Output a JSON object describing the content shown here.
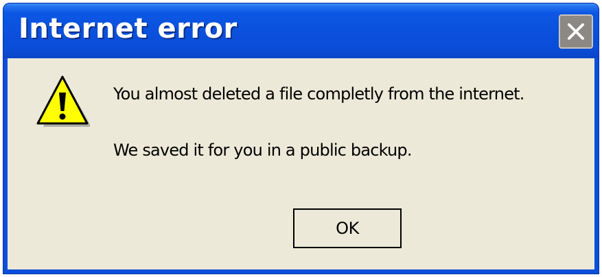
{
  "window": {
    "title": "Internet error"
  },
  "titlebar": {
    "close_icon": "close-icon"
  },
  "dialog": {
    "icon": "warning-icon",
    "message_line1": "You almost deleted a file completly from the internet.",
    "message_line2": "We saved it for you in a public backup.",
    "ok_label": "OK"
  },
  "colors": {
    "titlebar_blue": "#0a50dd",
    "dialog_background": "#ece9d8",
    "warning_yellow": "#ffff00",
    "close_button_gray": "#8c8883"
  }
}
